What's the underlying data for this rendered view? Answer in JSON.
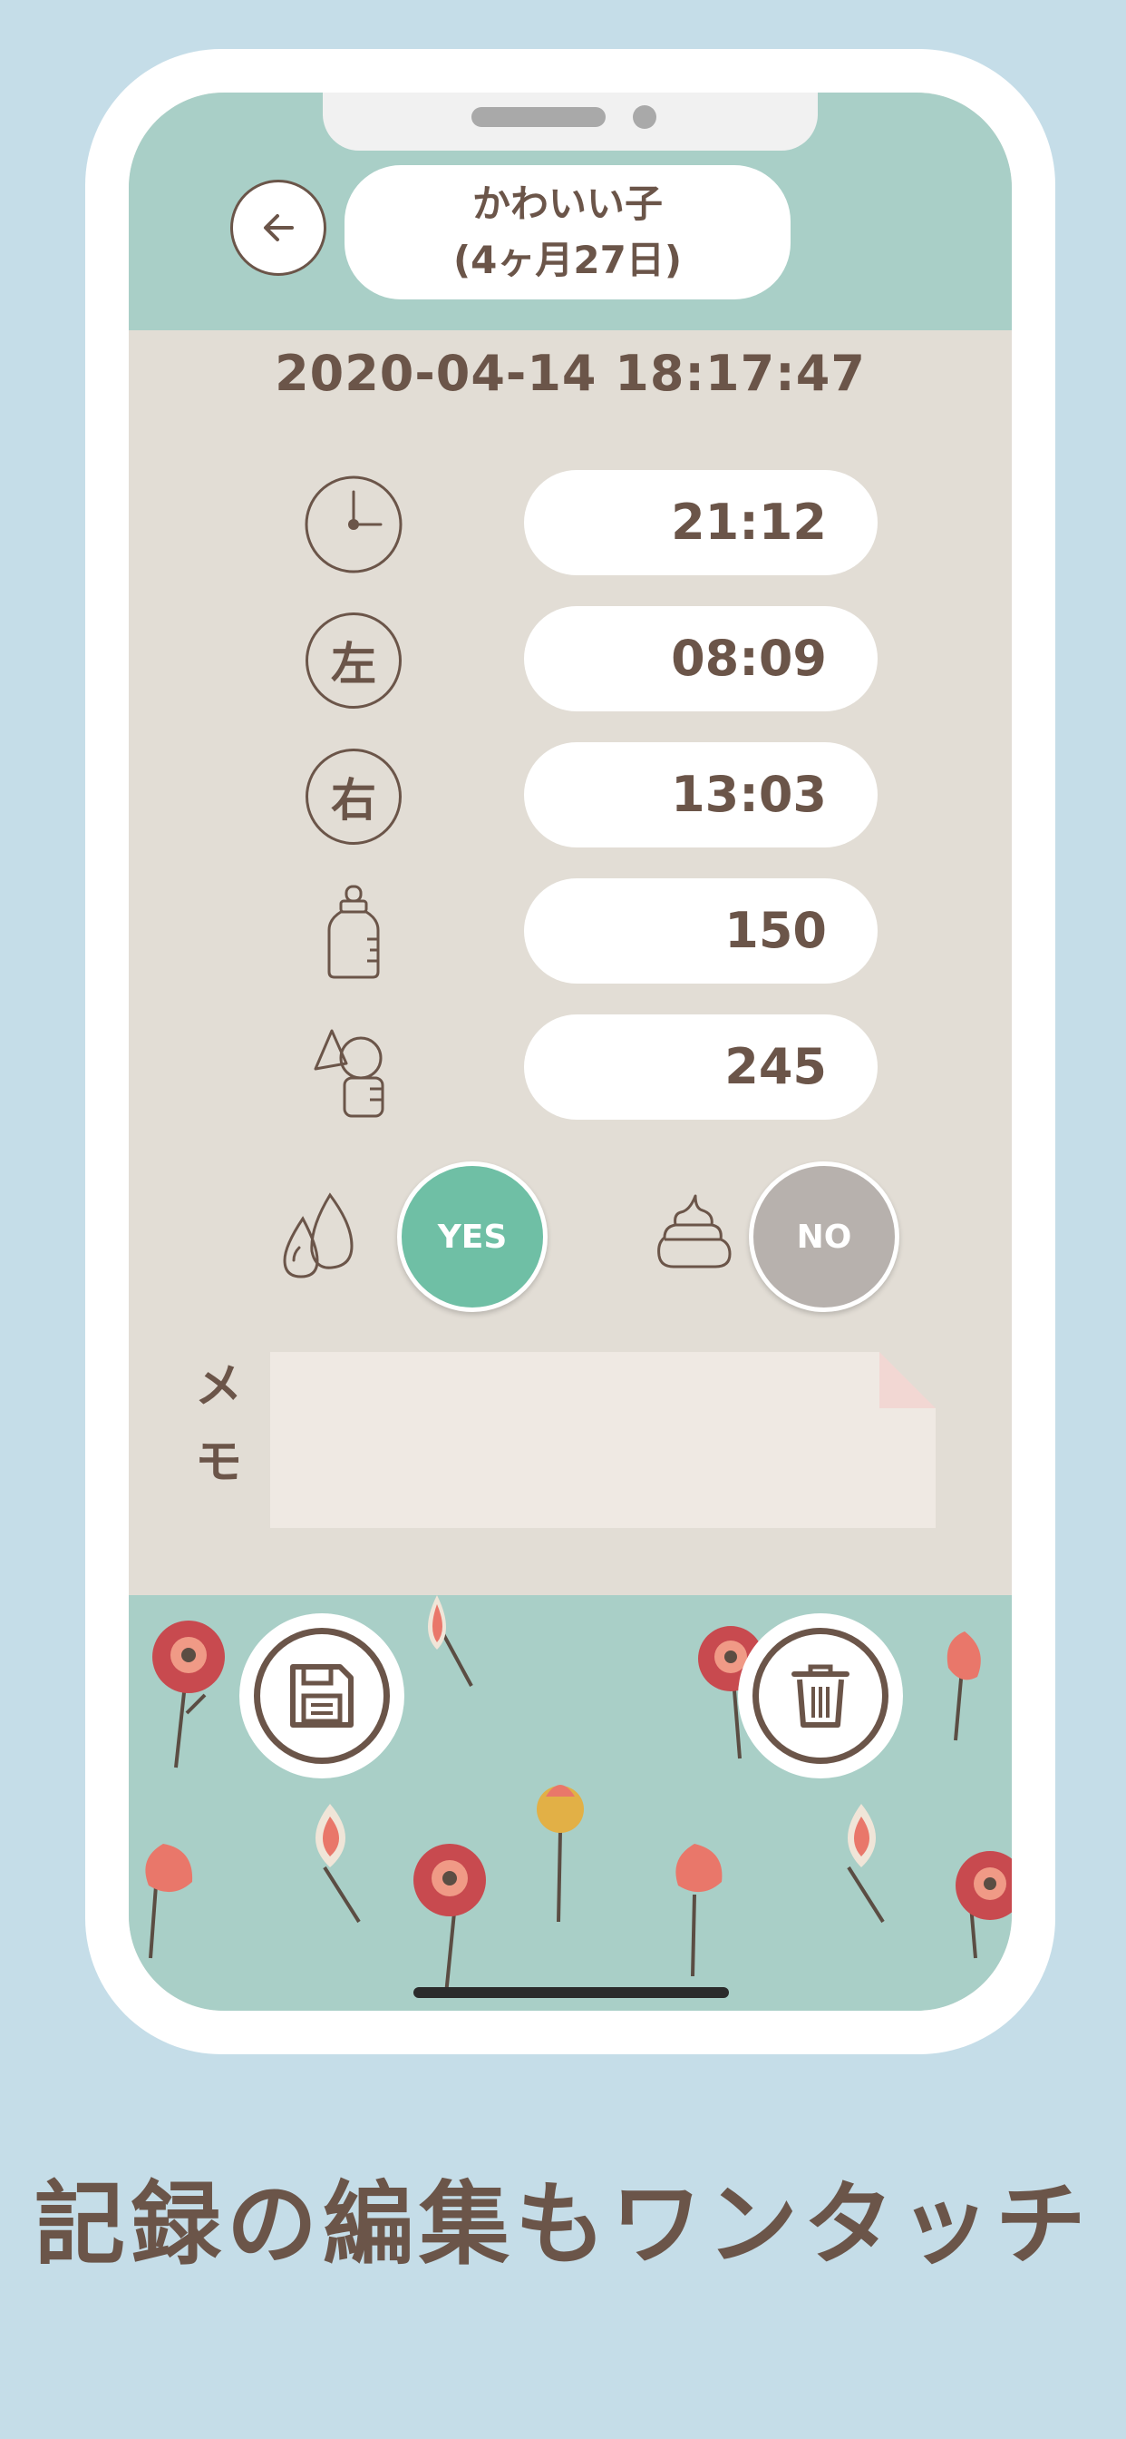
{
  "header": {
    "child_name": "かわいい子",
    "child_age": "(4ヶ月27日)"
  },
  "record": {
    "datetime": "2020-04-14 18:17:47",
    "time": "21:12",
    "left_label": "左",
    "left": "08:09",
    "right_label": "右",
    "right": "13:03",
    "bottle": "150",
    "pump": "245",
    "pee_toggle": "YES",
    "poop_toggle": "NO"
  },
  "memo": {
    "label_line1": "メ",
    "label_line2": "モ",
    "value": ""
  },
  "colors": {
    "background": "#c5dde8",
    "accent_mint": "#a9cfc7",
    "yes_green": "#6fbfa5",
    "no_gray": "#b7b1ad",
    "text_brown": "#6b5549"
  },
  "caption": "記録の編集もワンタッチ"
}
